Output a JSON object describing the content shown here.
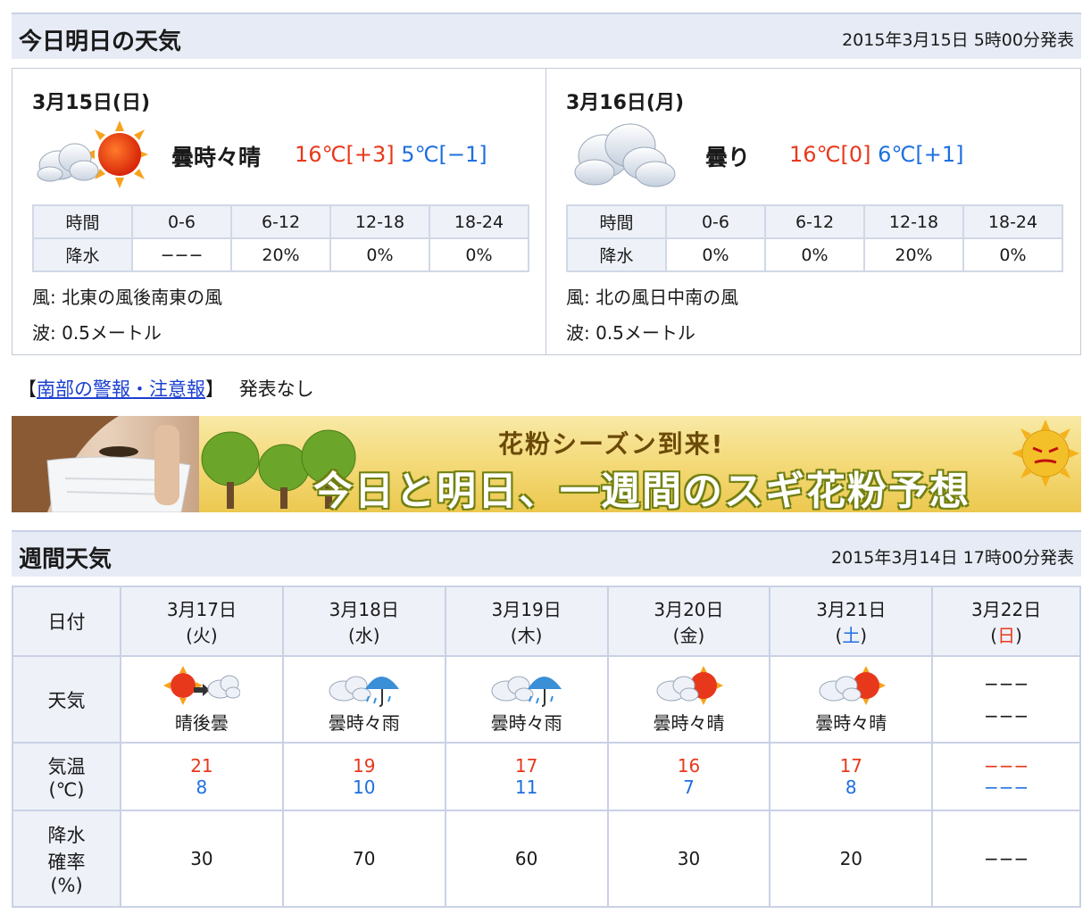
{
  "today_section": {
    "title": "今日明日の天気",
    "issued": "2015年3月15日 5時00分発表"
  },
  "days": [
    {
      "date": "3月15日(日)",
      "icon": "cloud-sun-icon",
      "weather": "曇時々晴",
      "high": "16℃[+3]",
      "low": "5℃[−1]",
      "time_label": "時間",
      "rain_label": "降水",
      "periods": [
        "0-6",
        "6-12",
        "12-18",
        "18-24"
      ],
      "rain": [
        "−−−",
        "20%",
        "0%",
        "0%"
      ],
      "wind": "風: 北東の風後南東の風",
      "wave": "波: 0.5メートル"
    },
    {
      "date": "3月16日(月)",
      "icon": "cloud-icon",
      "weather": "曇り",
      "high": "16℃[0]",
      "low": "6℃[+1]",
      "time_label": "時間",
      "rain_label": "降水",
      "periods": [
        "0-6",
        "6-12",
        "12-18",
        "18-24"
      ],
      "rain": [
        "0%",
        "0%",
        "20%",
        "0%"
      ],
      "wind": "風: 北の風日中南の風",
      "wave": "波: 0.5メートル"
    }
  ],
  "warning": {
    "open": "【",
    "link": "南部の警報・注意報",
    "close": "】",
    "status": "発表なし"
  },
  "banner": {
    "subtitle": "花粉シーズン到来!",
    "headline": "今日と明日、一週間のスギ花粉予想"
  },
  "week_section": {
    "title": "週間天気",
    "issued": "2015年3月14日 17時00分発表"
  },
  "week": {
    "row_labels": {
      "date": "日付",
      "weather": "天気",
      "temp_line1": "気温",
      "temp_line2": "(℃)",
      "pop_line1": "降水",
      "pop_line2": "確率",
      "pop_line3": "(%)"
    },
    "days": [
      {
        "date": "3月17日",
        "dow": "(火)",
        "dow_class": "",
        "icon": "sun-to-cloud-icon",
        "weather": "晴後曇",
        "high": "21",
        "low": "8",
        "pop": "30"
      },
      {
        "date": "3月18日",
        "dow": "(水)",
        "dow_class": "",
        "icon": "cloud-rain-icon",
        "weather": "曇時々雨",
        "high": "19",
        "low": "10",
        "pop": "70"
      },
      {
        "date": "3月19日",
        "dow": "(木)",
        "dow_class": "",
        "icon": "cloud-rain-icon",
        "weather": "曇時々雨",
        "high": "17",
        "low": "11",
        "pop": "60"
      },
      {
        "date": "3月20日",
        "dow": "(金)",
        "dow_class": "",
        "icon": "cloud-sun-icon",
        "weather": "曇時々晴",
        "high": "16",
        "low": "7",
        "pop": "30"
      },
      {
        "date": "3月21日",
        "dow_open": "(",
        "dow_mid": "土",
        "dow_close": ")",
        "dow_class": "sat",
        "icon": "cloud-sun-icon",
        "weather": "曇時々晴",
        "high": "17",
        "low": "8",
        "pop": "20"
      },
      {
        "date": "3月22日",
        "dow_open": "(",
        "dow_mid": "日",
        "dow_close": ")",
        "dow_class": "sun",
        "icon": "none",
        "weather_line1": "−−−",
        "weather": "−−−",
        "high": "−−−",
        "low": "−−−",
        "pop": "−−−"
      }
    ]
  },
  "colors": {
    "high": "#e8381b",
    "low": "#1e6fe0",
    "header_bg": "#e7ebf5",
    "border": "#c9d1e4"
  }
}
